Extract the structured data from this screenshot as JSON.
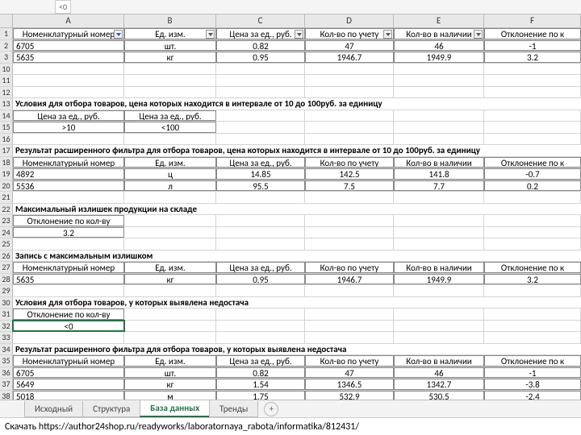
{
  "formula_ref": "<0",
  "columns": [
    "A",
    "B",
    "C",
    "D",
    "E",
    "F"
  ],
  "headers_main": [
    "Номенклатурный номер",
    "Ед. изм.",
    "Цена за ед., руб.",
    "Кол-во по учету",
    "Кол-во в наличии",
    "Отклонение по к"
  ],
  "row2": [
    "6705",
    "шт.",
    "0.82",
    "47",
    "46",
    "-1"
  ],
  "row3": [
    "5635",
    "кг",
    "0.95",
    "1946.7",
    "1949.9",
    "3.2"
  ],
  "title13": "Условия для отбора товаров, цена которых находится в интервале от 10 до 100руб. за единицу",
  "row14": [
    "Цена за ед., руб.",
    "Цена за ед., руб."
  ],
  "row15": [
    ">10",
    "<100"
  ],
  "title17": "Результат расширенного фильтра для отбора товаров, цена которых находится в интервале от 10 до 100руб. за единицу",
  "headers18": [
    "Номенклатурный номер",
    "Ед. изм.",
    "Цена за ед., руб.",
    "Кол-во по учету",
    "Кол-во в наличии",
    "Отклонение по к"
  ],
  "row19": [
    "4892",
    "ц",
    "14.85",
    "142.5",
    "141.8",
    "-0.7"
  ],
  "row20": [
    "5536",
    "л",
    "95.5",
    "7.5",
    "7.7",
    "0.2"
  ],
  "title22": "Максимальный излишек продукции на складе",
  "row23_label": "Отклонение по кол-ву",
  "row24_val": "3.2",
  "title26": "Запись с максимальным излишком",
  "headers27": [
    "Номенклатурный номер",
    "Ед. изм.",
    "Цена за ед., руб.",
    "Кол-во по учету",
    "Кол-во в наличии",
    "Отклонение по к"
  ],
  "row28": [
    "5635",
    "кг",
    "0.95",
    "1946.7",
    "1949.9",
    "3.2"
  ],
  "title30": "Условия для отбора товаров, у которых выявлена недостача",
  "row31_label": "Отклонение по кол-ву",
  "row32_val": "<0",
  "title34": "Результат расширенного фильтра для отбора товаров, у которых выявлена недостача",
  "headers35": [
    "Номенклатурный номер",
    "Ед. изм.",
    "Цена за ед., руб.",
    "Кол-во по учету",
    "Кол-во в наличии",
    "Отклонение по к"
  ],
  "row36": [
    "6705",
    "шт.",
    "0.82",
    "47",
    "46",
    "-1"
  ],
  "row37": [
    "5649",
    "кг",
    "1.54",
    "1346.5",
    "1342.7",
    "-3.8"
  ],
  "row38": [
    "5018",
    "м",
    "1.75",
    "532.9",
    "530.5",
    "-2.4"
  ],
  "tabs": [
    "Исходный",
    "Структура",
    "База данных",
    "Тренды"
  ],
  "active_tab": 2,
  "footer": "Скачать https://author24shop.ru/readyworks/laboratornaya_rabota/informatika/812431/"
}
